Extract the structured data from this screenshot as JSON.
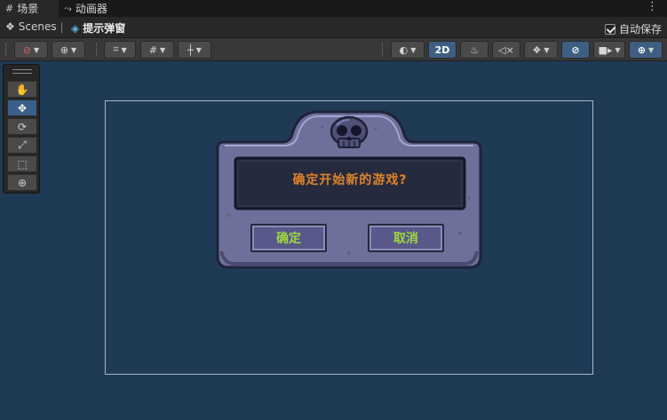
{
  "tabs": [
    {
      "label": "场景",
      "icon": "grid-icon",
      "active": true
    },
    {
      "label": "动画器",
      "icon": "branch-icon",
      "active": false
    }
  ],
  "breadcrumb": {
    "root": "Scenes",
    "current": "提示弹窗"
  },
  "autosave": {
    "label": "自动保存",
    "checked": true
  },
  "toolbar": {
    "mode_2d": "2D"
  },
  "tool_palette": [
    {
      "name": "hand-tool",
      "glyph": "✋"
    },
    {
      "name": "move-tool",
      "glyph": "✥"
    },
    {
      "name": "rotate-tool",
      "glyph": "⟳"
    },
    {
      "name": "scale-tool",
      "glyph": "⤢"
    },
    {
      "name": "rect-tool",
      "glyph": "⬚"
    },
    {
      "name": "transform-tool",
      "glyph": "⊕"
    }
  ],
  "popup": {
    "message": "确定开始新的游戏?",
    "confirm_label": "确定",
    "cancel_label": "取消"
  },
  "colors": {
    "scene_bg": "#1f3a55",
    "message_text": "#e0852a",
    "button_text": "#9fd83f",
    "stone_frame": "#6f6f9b",
    "active_tool": "#3b5f88"
  }
}
